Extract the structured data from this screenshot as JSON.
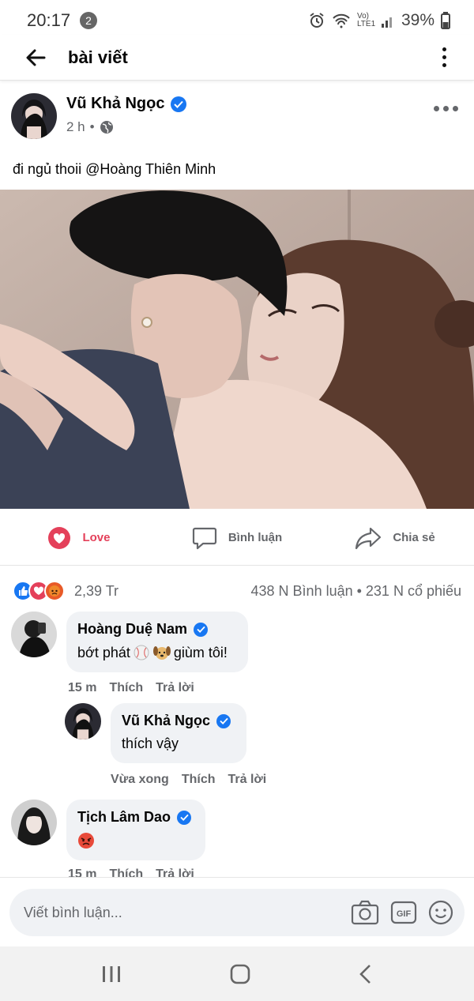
{
  "status_bar": {
    "time": "20:17",
    "notif_count": "2",
    "network": "Vo) LTE1",
    "battery": "39%"
  },
  "header": {
    "title": "bài viết"
  },
  "post": {
    "author": "Vũ Khả Ngọc",
    "time": "2 h",
    "caption": "đi ngủ thoii @Hoàng Thiên Minh"
  },
  "actions": {
    "love": "Love",
    "comment": "Bình luận",
    "share": "Chia sẻ"
  },
  "reactions": {
    "count": "2,39 Tr",
    "summary": "438 N Bình luận • 231 N cổ phiếu"
  },
  "comments": [
    {
      "name": "Hoàng Duệ Nam",
      "text_before": "bớt phát",
      "text_after": "giùm tôi!",
      "time": "15 m",
      "like": "Thích",
      "reply": "Trả lời"
    },
    {
      "name": "Vũ Khả Ngọc",
      "text": "thích vậy",
      "time": "Vừa xong",
      "like": "Thích",
      "reply": "Trả lời"
    },
    {
      "name": "Tịch Lâm Dao",
      "time": "15 m",
      "like": "Thích",
      "reply": "Trả lời"
    }
  ],
  "comment_input": {
    "placeholder": "Viết bình luận..."
  },
  "colors": {
    "accent": "#1877f2",
    "love": "#e4405a",
    "bubble": "#f0f2f5"
  }
}
